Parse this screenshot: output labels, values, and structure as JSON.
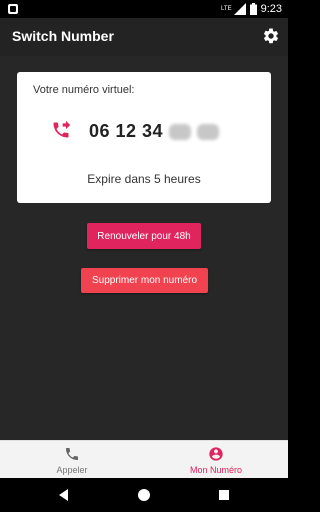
{
  "status_bar": {
    "time": "9:23",
    "network": "LTE",
    "icons": [
      "app-notification-icon",
      "signal-icon",
      "battery-icon"
    ]
  },
  "app_bar": {
    "title": "Switch Number",
    "settings_icon": "gear-icon"
  },
  "card": {
    "label": "Votre numéro virtuel:",
    "number_visible": "06 12 34",
    "expire_text": "Expire dans 5 heures",
    "icon": "phone-forward-icon"
  },
  "actions": {
    "renew_label": "Renouveler pour 48h",
    "delete_label": "Supprimer mon numéro"
  },
  "bottom_nav": {
    "items": [
      {
        "label": "Appeler",
        "icon": "phone-icon",
        "active": false
      },
      {
        "label": "Mon Numéro",
        "icon": "account-icon",
        "active": true
      }
    ]
  },
  "colors": {
    "accent": "#e0245e",
    "delete": "#f0434f",
    "background": "#272727",
    "app_bar": "#232323"
  }
}
